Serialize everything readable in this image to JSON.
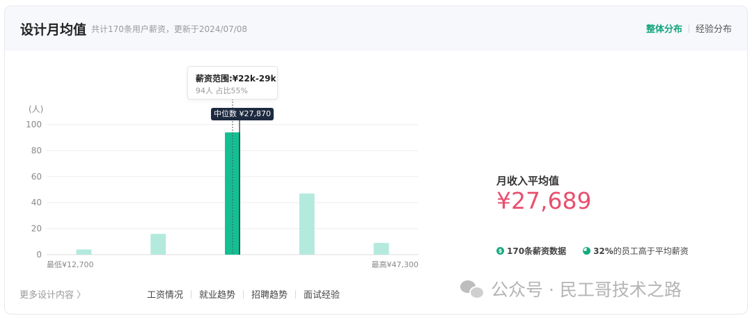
{
  "header": {
    "title": "设计月均值",
    "subtitle": "共计170条用户薪资，更新于2024/07/08",
    "tabs": [
      "整体分布",
      "经验分布"
    ]
  },
  "chart_data": {
    "type": "bar",
    "categories": [
      "",
      "",
      "¥22k-29k",
      "",
      ""
    ],
    "values": [
      4,
      16,
      94,
      47,
      9
    ],
    "ylabel": "(人)",
    "ylim": [
      0,
      100
    ],
    "yticks": [
      0,
      20,
      40,
      60,
      80,
      100
    ],
    "grid": true,
    "highlight_index": 2,
    "colors": {
      "bar": "#b4eadd",
      "highlight": "#13bf93",
      "grid": "#ededed",
      "median": "#1d2a3f"
    },
    "x_min_label": "最低¥12,700",
    "x_max_label": "最高¥47,300",
    "median_label": "中位数 ¥27,870",
    "tooltip": {
      "title": "薪资范围:¥22k-29k",
      "detail": "94人  占比55%"
    }
  },
  "stats": {
    "avg_label": "月收入平均值",
    "avg_value": "¥27,689",
    "count_label": "170条薪资数据",
    "pct_bold": "32%",
    "pct_text": "的员工高于平均薪资"
  },
  "footer": {
    "more": "更多设计内容 〉",
    "nav": [
      "工资情况",
      "就业趋势",
      "招聘趋势",
      "面试经验"
    ]
  },
  "watermark": "公众号 · 民工哥技术之路"
}
